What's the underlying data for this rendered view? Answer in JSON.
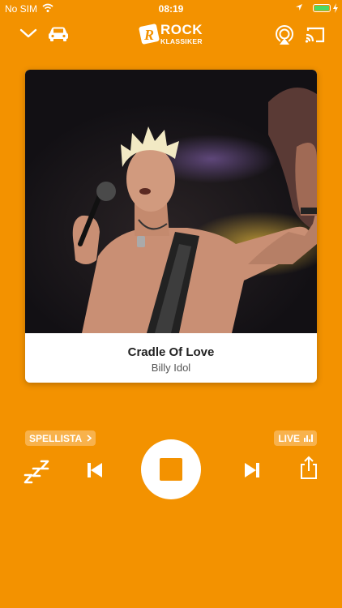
{
  "status_bar": {
    "carrier": "No SIM",
    "time": "08:19"
  },
  "logo": {
    "line1": "ROCK",
    "line2": "KLASSIKER"
  },
  "now_playing": {
    "title": "Cradle Of Love",
    "artist": "Billy Idol"
  },
  "controls": {
    "playlist_label": "SPELLISTA",
    "live_label": "LIVE"
  },
  "colors": {
    "background": "#F39200",
    "chip": "#F8B24C",
    "battery": "#4CD964"
  }
}
